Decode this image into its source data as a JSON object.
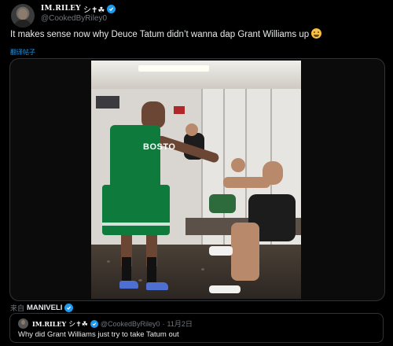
{
  "tweet": {
    "author_name": "IM.RILEY",
    "author_symbols": "シ✝☘",
    "handle": "@CookedByRiley0",
    "text": "It makes sense now why Deuce Tatum didn’t wanna dap Grant Williams up",
    "translate_label": "翻译帖子",
    "jersey_text": "BOSTO",
    "attribution_prefix": "来自",
    "attribution_source": "MANIVELI"
  },
  "quoted": {
    "author_name": "IM.RILEY",
    "author_symbols": "シ✝☘",
    "handle": "@CookedByRiley0",
    "separator": "·",
    "date": "11月2日",
    "text": "Why did Grant Williams just try to take Tatum out"
  },
  "colors": {
    "background": "#000000",
    "accent": "#1d9bf0",
    "secondary_text": "#71767b",
    "jersey_green": "#0e7a3c"
  },
  "icons": {
    "verified": "verified-badge-icon",
    "emoji": "crying-laughing-face"
  }
}
